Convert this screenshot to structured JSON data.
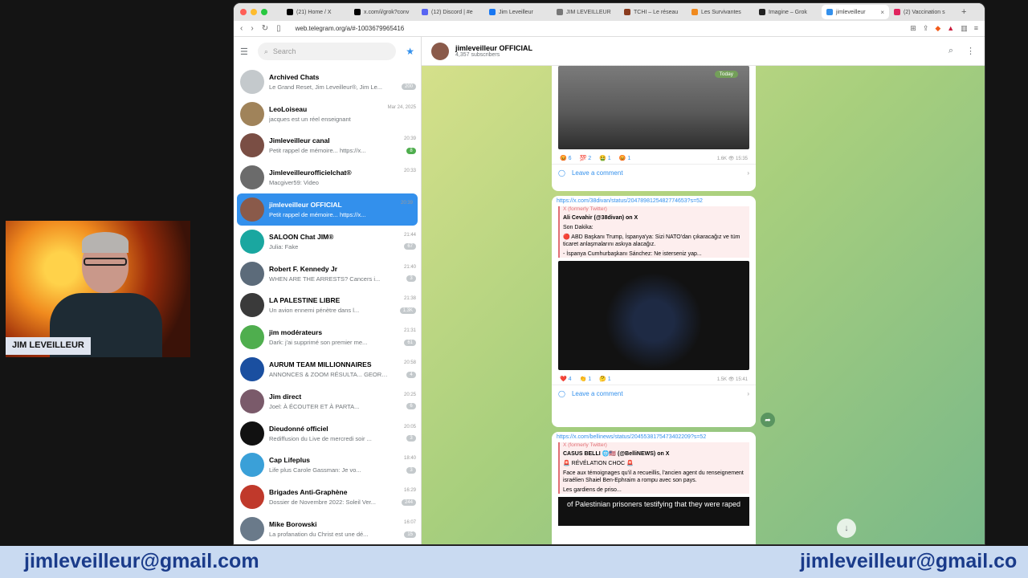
{
  "browser": {
    "tabs": [
      {
        "label": "(21) Home / X",
        "color": "#000000"
      },
      {
        "label": "x.com/i/grok?conv",
        "color": "#000000"
      },
      {
        "label": "(12) Discord | #e",
        "color": "#5865f2"
      },
      {
        "label": "Jim Leveilleur",
        "color": "#1877f2"
      },
      {
        "label": "JIM LEVEILLEUR",
        "color": "#777777"
      },
      {
        "label": "TCHI – Le réseau",
        "color": "#8a3b1e"
      },
      {
        "label": "Les Survivantes",
        "color": "#f08a1e"
      },
      {
        "label": "Imagine – Grok",
        "color": "#222222"
      },
      {
        "label": "jimleveilleur",
        "color": "#3390ec"
      },
      {
        "label": "(2) Vaccination s",
        "color": "#e0245e"
      }
    ],
    "url": "web.telegram.org/a/#-1003679965416"
  },
  "sidebar": {
    "search_placeholder": "Search",
    "chats": [
      {
        "name": "Archived Chats",
        "preview": "Le Grand Reset, Jim Leveilleur®, Jim Le...",
        "time": "",
        "badge": "200",
        "avatar": "#c4c9cc"
      },
      {
        "name": "LeoLoiseau",
        "preview": "jacques est un réel enseignant",
        "time": "Mar 24, 2025",
        "badge": "",
        "avatar": "#a0835a"
      },
      {
        "name": "Jimleveilleur canal",
        "preview": "Petit rappel de mémoire... https://x...",
        "time": "20:39",
        "badge": "8",
        "avatar": "#7a4e44"
      },
      {
        "name": "Jimleveilleurofficielchat®",
        "preview": "Macgiver59: Video",
        "time": "20:33",
        "badge": "",
        "avatar": "#6b6b6b"
      },
      {
        "name": "jimleveilleur OFFICIAL",
        "preview": "Petit rappel de mémoire... https://x...",
        "time": "20:39",
        "badge": "",
        "avatar": "#8a5a4a"
      },
      {
        "name": "SALOON Chat JIM®",
        "preview": "Julia: Fake",
        "time": "21:44",
        "badge": "67",
        "avatar": "#1aa7a0"
      },
      {
        "name": "Robert F. Kennedy Jr",
        "preview": "WHEN ARE THE ARRESTS? Cancers i...",
        "time": "21:40",
        "badge": "3",
        "avatar": "#5c6b7a"
      },
      {
        "name": "LA PALESTINE LIBRE",
        "preview": "Un avion ennemi pénètre dans l...",
        "time": "21:38",
        "badge": "1.3K",
        "avatar": "#3a3a3a"
      },
      {
        "name": "jim modérateurs",
        "preview": "Dark: j'ai supprimé son premier me...",
        "time": "21:31",
        "badge": "61",
        "avatar": "#4fae4e"
      },
      {
        "name": "AURUM TEAM MILLIONNAIRES",
        "preview": "ANNONCES & ZOOM RÉSULTA... GEORGIO: !!!!!!",
        "time": "20:58",
        "badge": "4",
        "avatar": "#1a4fa0"
      },
      {
        "name": "Jim direct",
        "preview": "Joel: À ÉCOUTER ET À PARTA...",
        "time": "20:25",
        "badge": "6",
        "avatar": "#7a5a6a"
      },
      {
        "name": "Dieudonné officiel",
        "preview": "Rediffusion du Live de mercredi soir ...",
        "time": "20:05",
        "badge": "3",
        "avatar": "#111111"
      },
      {
        "name": "Cap Lifeplus",
        "preview": "Life plus Carole Gassman: Je vo...",
        "time": "18:40",
        "badge": "3",
        "avatar": "#3aa0d8"
      },
      {
        "name": "Brigades Anti-Graphène",
        "preview": "Dossier de Novembre 2022: Soleil Ver...",
        "time": "16:29",
        "badge": "244",
        "avatar": "#c0392b"
      },
      {
        "name": "Mike Borowski",
        "preview": "La profanation du Christ est une dé...",
        "time": "16:07",
        "badge": "15",
        "avatar": "#6a7a8a"
      }
    ]
  },
  "channel": {
    "title": "jimleveilleur OFFICIAL",
    "subscribers": "4,357 subscribers"
  },
  "posts": [
    {
      "today": "Today",
      "reactions": [
        "😡 6",
        "💯 2",
        "🤮 1",
        "😡 1"
      ],
      "meta": "1.6K 👁 15:35",
      "comment": "Leave a comment"
    },
    {
      "link": "https://x.com/38divan/status/2047898125482774653?s=52",
      "source": "X (formerly Twitter)",
      "author": "Ali Cevahir (@38divan) on X",
      "line1": "Son Dakika:",
      "line2": "🔴 ABD Başkanı Trump, İspanya'ya: Sizi NATO'dan çıkaracağız ve tüm ticaret anlaşmalarını askıya alacağız.",
      "line3": "- İspanya Cumhurbaşkanı Sánchez: Ne isterseniz yap...",
      "reactions": [
        "❤️ 4",
        "👏 1",
        "🤔 1"
      ],
      "meta": "1.5K 👁 15:41",
      "comment": "Leave a comment"
    },
    {
      "link": "https://x.com/bellinews/status/2045538175473402209?s=52",
      "source": "X (formerly Twitter)",
      "author": "CASUS BELLI 🌐🇺🇸 (@BelliNEWS) on X",
      "line1": "🚨 RÉVÉLATION CHOC 🚨",
      "line2": "Face aux témoignages qu'il a recueillis, l'ancien agent du renseignement israélien Shaiel Ben-Ephraim a rompu avec son pays.",
      "line3": "Les gardiens de priso...",
      "video_caption": "of Palestinian prisoners testifying that they were raped"
    }
  ],
  "webcam": {
    "label": "JIM LEVEILLEUR"
  },
  "banner": {
    "email_left": "jimleveilleur@gmail.com",
    "email_right": "jimleveilleur@gmail.co"
  }
}
